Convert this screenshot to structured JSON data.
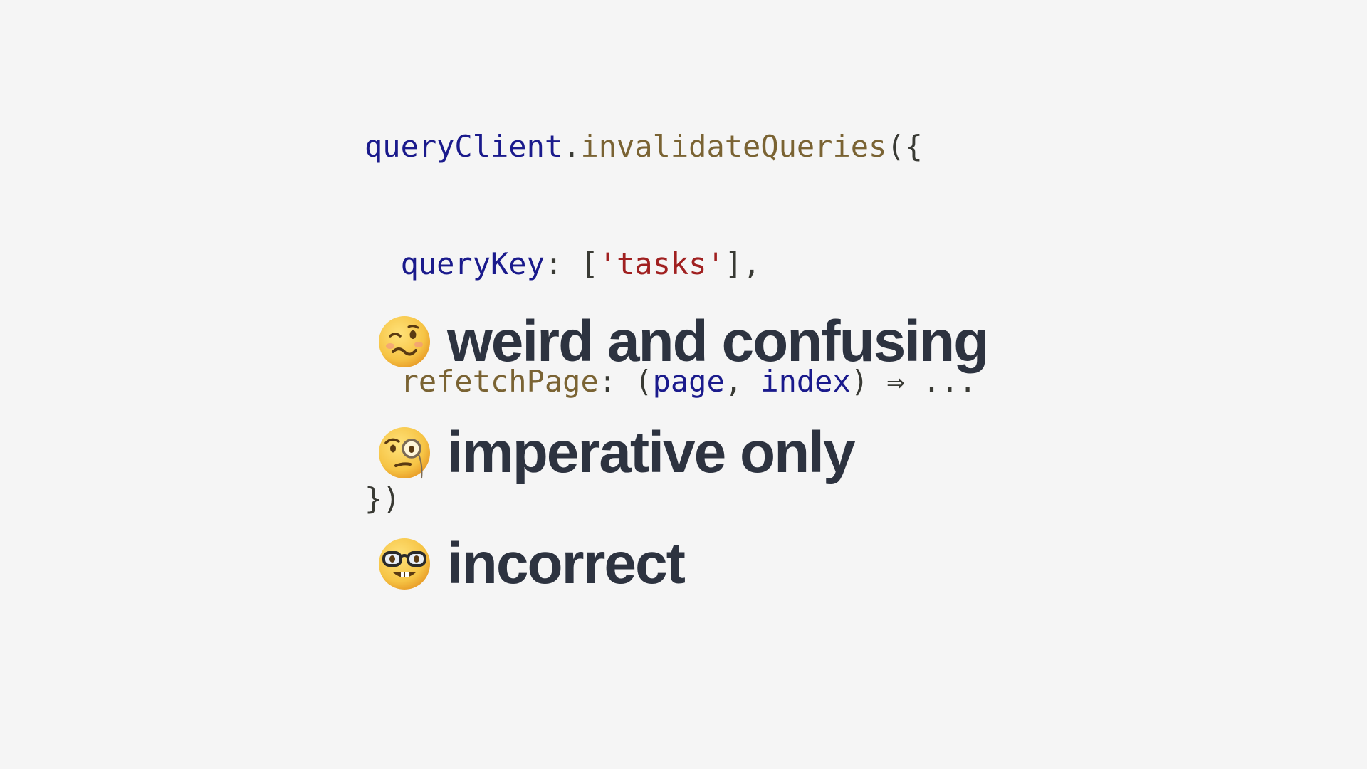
{
  "code": {
    "line1": {
      "obj": "queryClient",
      "dot": ".",
      "method": "invalidateQueries",
      "open": "({"
    },
    "line2": {
      "indent": "  ",
      "key": "queryKey",
      "colon": ": [",
      "value": "'tasks'",
      "close": "],"
    },
    "line3": {
      "indent": "  ",
      "key": "refetchPage",
      "colon": ": (",
      "param1": "page",
      "sep": ", ",
      "param2": "index",
      "arrow": ") ⇒ ..."
    },
    "line4": {
      "close": "})"
    }
  },
  "bullets": [
    {
      "icon": "woozy-face-icon",
      "text": "weird and confusing"
    },
    {
      "icon": "monocle-face-icon",
      "text": "imperative only"
    },
    {
      "icon": "nerd-face-icon",
      "text": "incorrect"
    }
  ],
  "colors": {
    "background": "#f5f5f5",
    "text": "#2d3340",
    "code_variable": "#1a1a8c",
    "code_function": "#7a6333",
    "code_string": "#a02020",
    "emoji_yellow": "#f6c445"
  }
}
